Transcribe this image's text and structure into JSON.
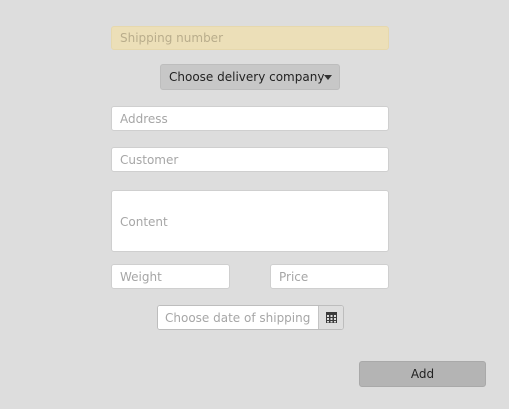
{
  "form": {
    "shipping_number": {
      "placeholder": "Shipping number",
      "value": ""
    },
    "delivery_company": {
      "selected": "Choose delivery company"
    },
    "address": {
      "placeholder": "Address",
      "value": ""
    },
    "customer": {
      "placeholder": "Customer",
      "value": ""
    },
    "content": {
      "placeholder": "Content",
      "value": ""
    },
    "weight": {
      "placeholder": "Weight",
      "value": ""
    },
    "price": {
      "placeholder": "Price",
      "value": ""
    },
    "shipping_date": {
      "placeholder": "Choose date of shipping",
      "value": "",
      "icon": "calendar-icon"
    },
    "add_label": "Add"
  },
  "colors": {
    "background": "#dddddd",
    "shipping_number_bg": "#ecdfb8",
    "dropdown_bg": "#c7c7c7",
    "button_bg": "#b4b4b4"
  }
}
